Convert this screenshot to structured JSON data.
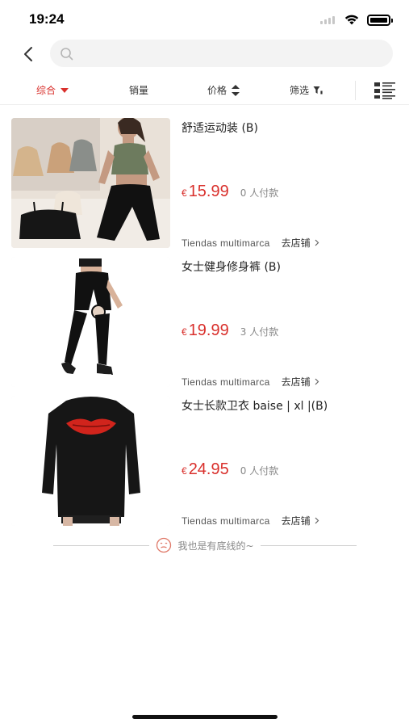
{
  "status_bar": {
    "time": "19:24"
  },
  "search": {
    "placeholder": ""
  },
  "filters": [
    {
      "label": "综合",
      "active": true,
      "indicator": "caret-down"
    },
    {
      "label": "销量",
      "active": false,
      "indicator": "none"
    },
    {
      "label": "价格",
      "active": false,
      "indicator": "sort-arrows"
    },
    {
      "label": "筛选",
      "active": false,
      "indicator": "filter"
    }
  ],
  "products": [
    {
      "title": "舒适运动装 (B)",
      "currency": "€",
      "price": "15.99",
      "sold": "0 人付款",
      "store": "Tiendas multimarca",
      "store_link": "去店铺"
    },
    {
      "title": "女士健身修身裤 (B)",
      "currency": "€",
      "price": "19.99",
      "sold": "3 人付款",
      "store": "Tiendas multimarca",
      "store_link": "去店铺"
    },
    {
      "title": "女士长款卫衣 baise | xl |(B)",
      "currency": "€",
      "price": "24.95",
      "sold": "0 人付款",
      "store": "Tiendas multimarca",
      "store_link": "去店铺"
    }
  ],
  "end_of_list": "我也是有底线的~",
  "colors": {
    "accent": "#d9302c",
    "muted": "#888888"
  }
}
